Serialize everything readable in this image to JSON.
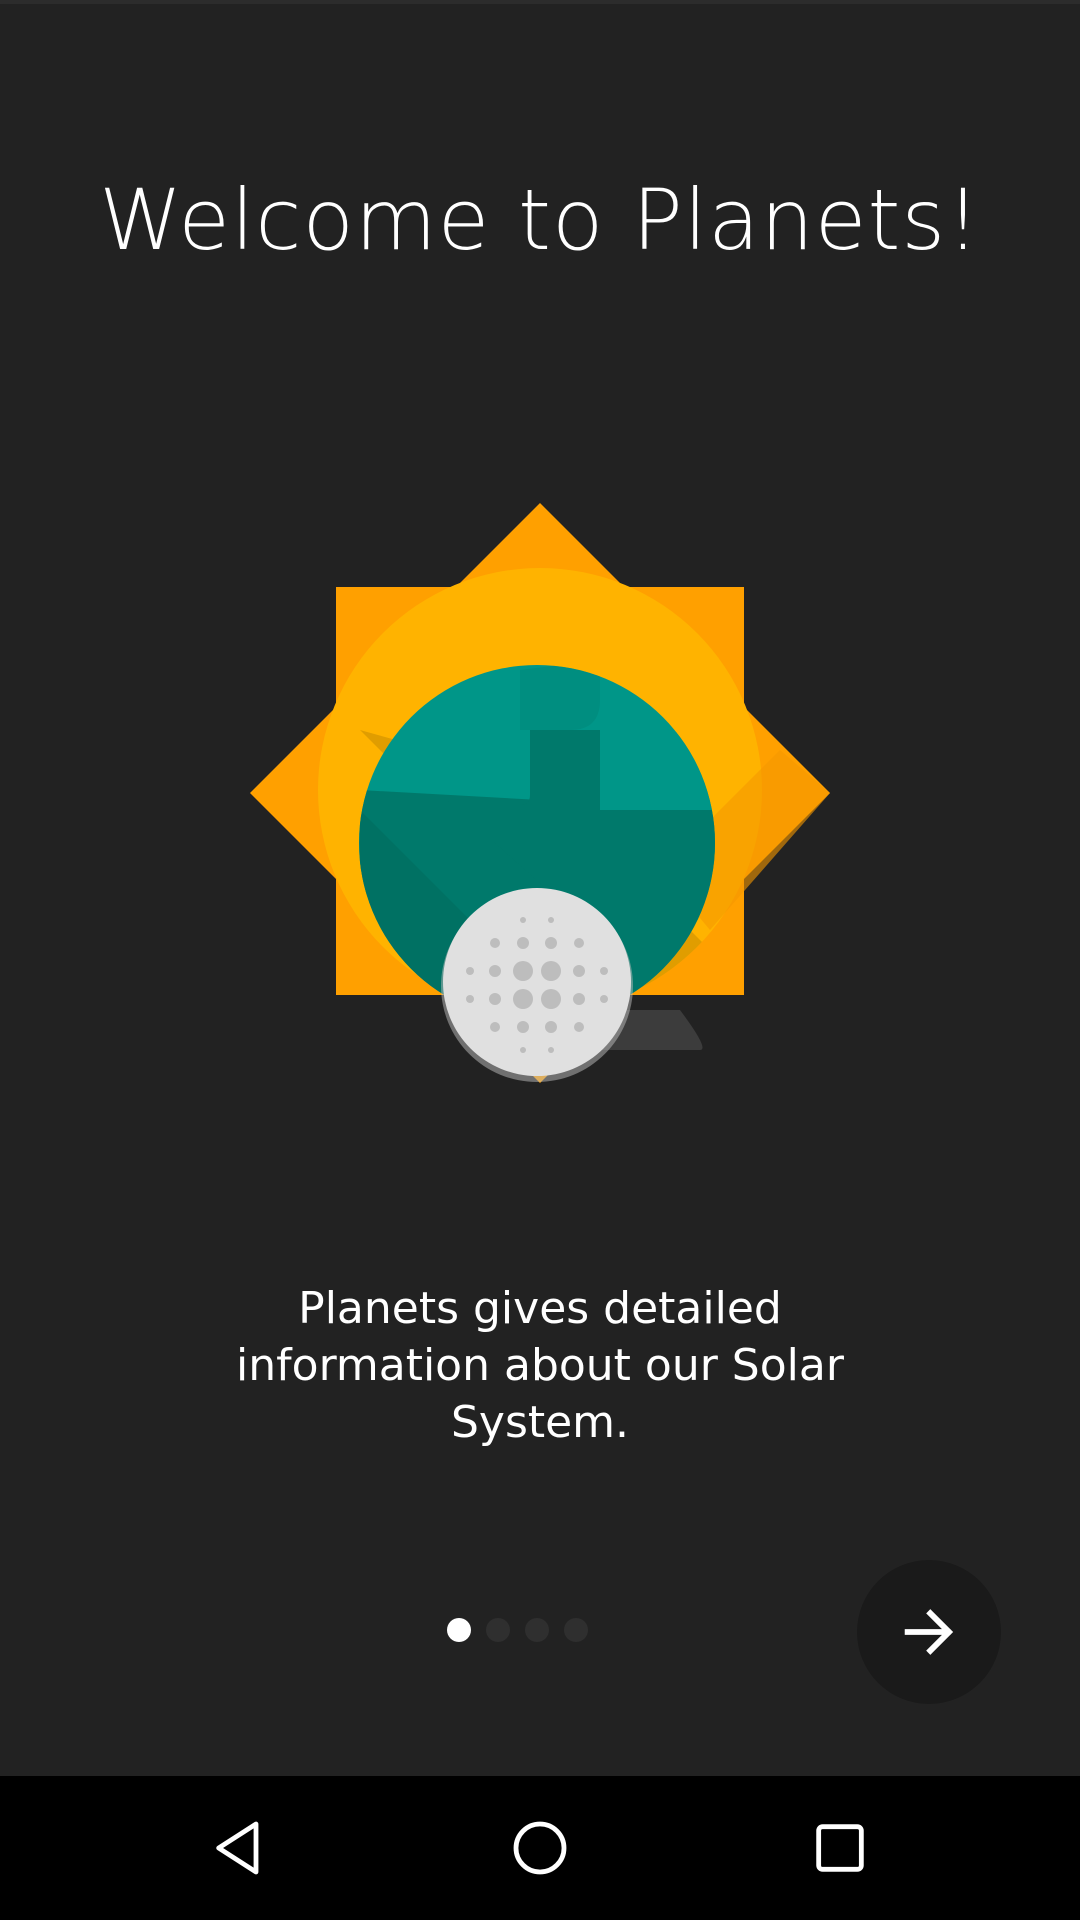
{
  "welcome": {
    "title": "Welcome to Planets!",
    "description": "Planets gives detailed information about our Solar System."
  },
  "pager": {
    "page_count": 4,
    "current_page": 1
  },
  "icons": {
    "next": "arrow-forward-icon",
    "back": "nav-back-icon",
    "home": "nav-home-icon",
    "recents": "nav-recents-icon"
  },
  "colors": {
    "background": "#222222",
    "sun": "#FFA000",
    "planet": "#009688",
    "moon": "#E0E0E0"
  }
}
